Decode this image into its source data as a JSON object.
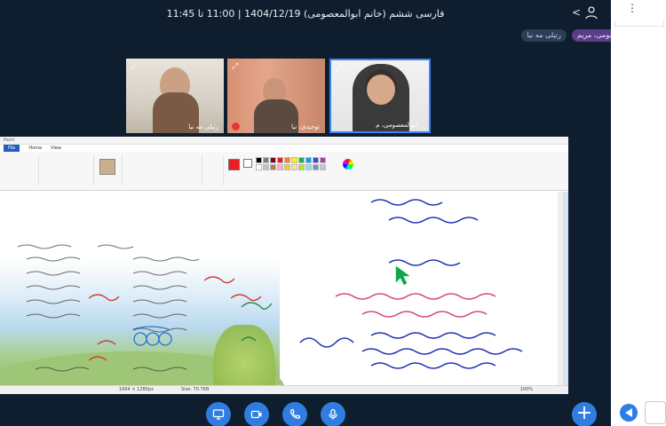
{
  "header": {
    "meeting_title": "فارسی ششم (خانم ابوالمعصومی) 1404/12/19 | 11:00 تا 11:45",
    "back_label": "<"
  },
  "participants": {
    "others": "رتیلی مه نیا",
    "self": "ابوالمعصومی، مریم"
  },
  "videos": [
    {
      "name": "رتیلی مه نیا"
    },
    {
      "name": "توحیدی، نیا"
    },
    {
      "name": "ابوالمعصومی، م..."
    }
  ],
  "paint": {
    "title": "Paint",
    "tabs": [
      "File",
      "Home",
      "View"
    ],
    "dims": "1664 × 1280px",
    "size": "Size: 70.7KB",
    "zoom": "100%"
  },
  "colors": {
    "accent": "#2f7de1",
    "bg": "#0f1e2e",
    "chip_self": "#5b3d8a",
    "swatches": [
      "#000000",
      "#7f7f7f",
      "#880015",
      "#ed1c24",
      "#ff7f27",
      "#fff200",
      "#22b14c",
      "#00a2e8",
      "#3f48cc",
      "#a349a4",
      "#ffffff",
      "#c3c3c3",
      "#b97a57",
      "#ffaec9",
      "#ffc90e",
      "#efe4b0",
      "#b5e61d",
      "#99d9ea",
      "#7092be",
      "#c8bfe7"
    ]
  },
  "controls": [
    "screen-share-icon",
    "camera-icon",
    "phone-icon",
    "microphone-icon"
  ],
  "add_label": "+"
}
